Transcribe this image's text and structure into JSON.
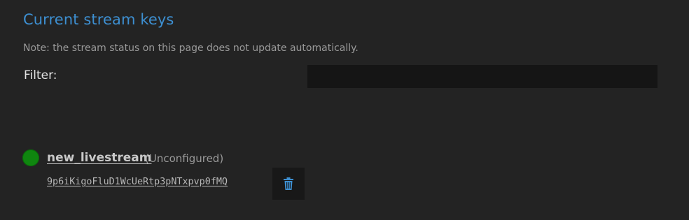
{
  "page": {
    "heading": "Current stream keys",
    "note": "Note: the stream status on this page does not update automatically."
  },
  "filter": {
    "label": "Filter:",
    "value": "",
    "placeholder": ""
  },
  "streams": [
    {
      "name": "new_livestream",
      "status_text": "(Unconfigured)",
      "status_color": "#0f860f",
      "key": "9p6iKigoFluD1WcUeRtp3pNTxpvp0fMQ",
      "delete_icon": "trash-icon"
    }
  ],
  "colors": {
    "background": "#232323",
    "accent": "#3d8fd1",
    "status_online": "#0f860f"
  }
}
